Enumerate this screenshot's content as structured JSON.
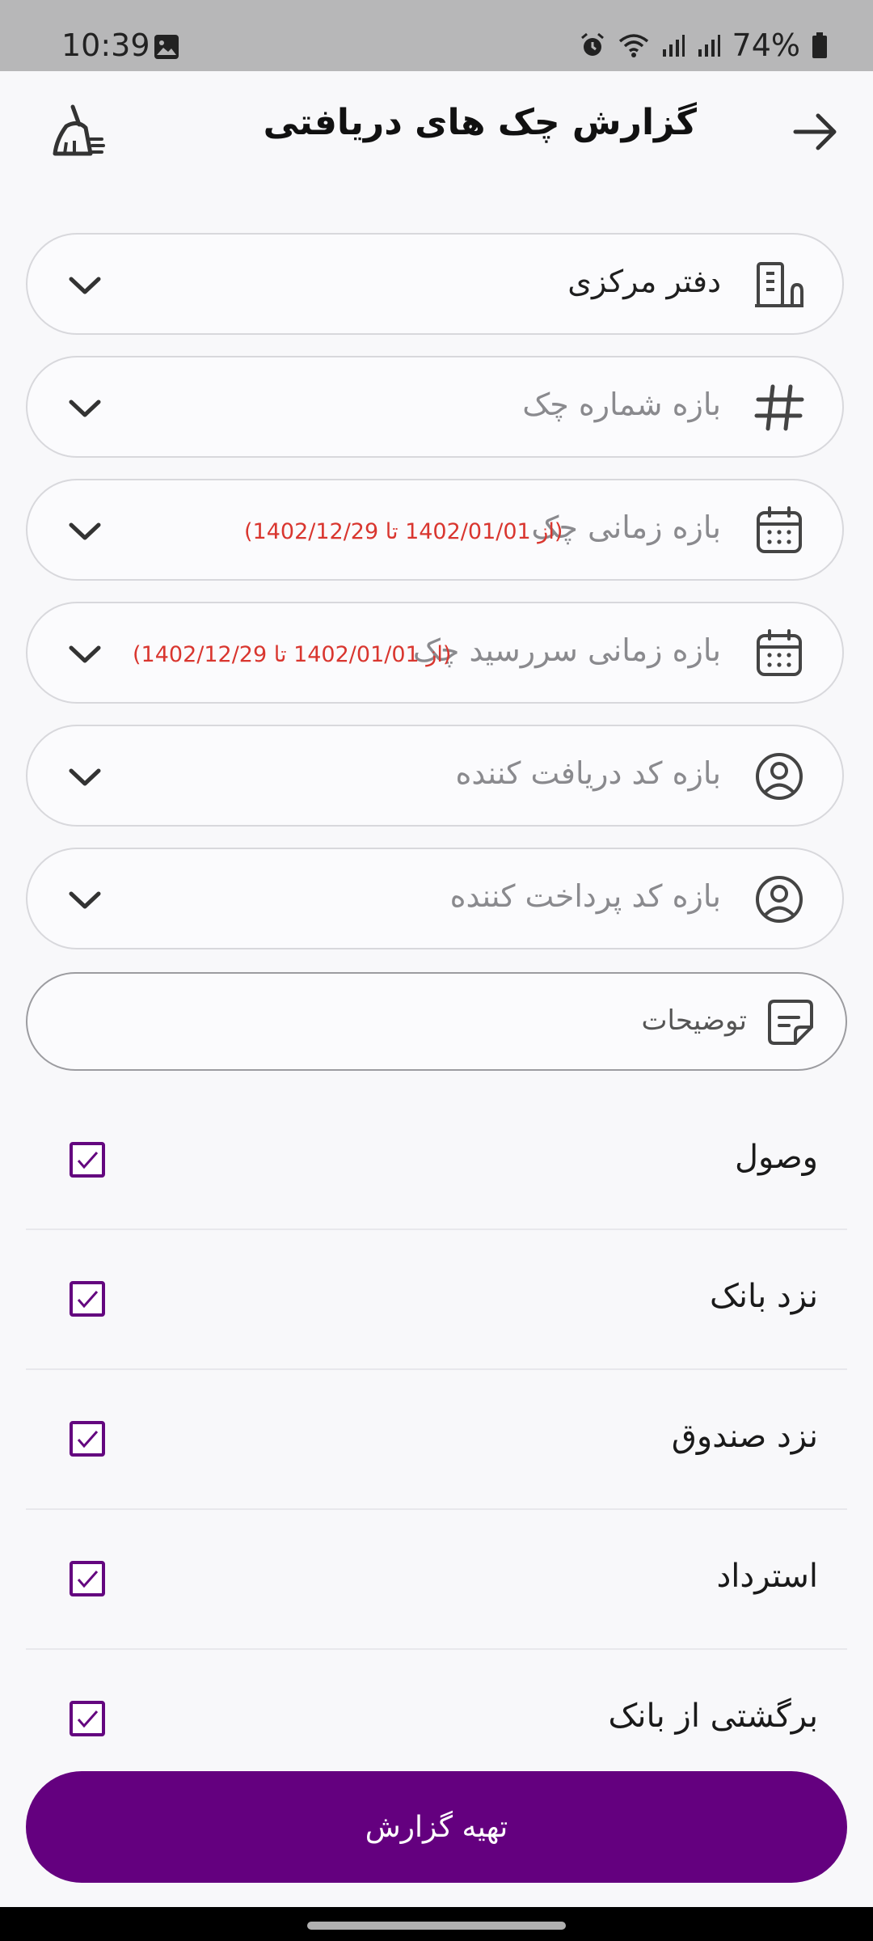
{
  "status_bar": {
    "time": "10:39",
    "battery": "74%"
  },
  "header": {
    "title": "گزارش چک های دریافتی",
    "back_icon": "arrow-right-icon",
    "clear_icon": "broom-icon"
  },
  "filters": {
    "office": {
      "value": "دفتر مرکزی",
      "icon": "building-icon"
    },
    "check_number_range": {
      "placeholder": "بازه شماره چک",
      "icon": "hash-icon"
    },
    "check_date_range": {
      "label": "بازه زمانی چک",
      "range": "(از 1402/01/01 تا 1402/12/29)",
      "icon": "calendar-icon"
    },
    "due_date_range": {
      "label": "بازه زمانی سررسید چک",
      "range": "(از 1402/01/01 تا 1402/12/29)",
      "icon": "calendar-icon"
    },
    "receiver_code_range": {
      "placeholder": "بازه کد دریافت کننده",
      "icon": "user-circle-icon"
    },
    "payer_code_range": {
      "placeholder": "بازه کد پرداخت کننده",
      "icon": "user-circle-icon"
    },
    "notes": {
      "placeholder": "توضیحات",
      "icon": "note-icon"
    }
  },
  "statuses": [
    {
      "label": "وصول",
      "checked": true
    },
    {
      "label": "نزد بانک",
      "checked": true
    },
    {
      "label": "نزد صندوق",
      "checked": true
    },
    {
      "label": "استرداد",
      "checked": true
    },
    {
      "label": "برگشتی از بانک",
      "checked": true
    }
  ],
  "actions": {
    "submit": "تهیه گزارش"
  },
  "colors": {
    "accent": "#64007f",
    "range_text": "#d9362f"
  }
}
